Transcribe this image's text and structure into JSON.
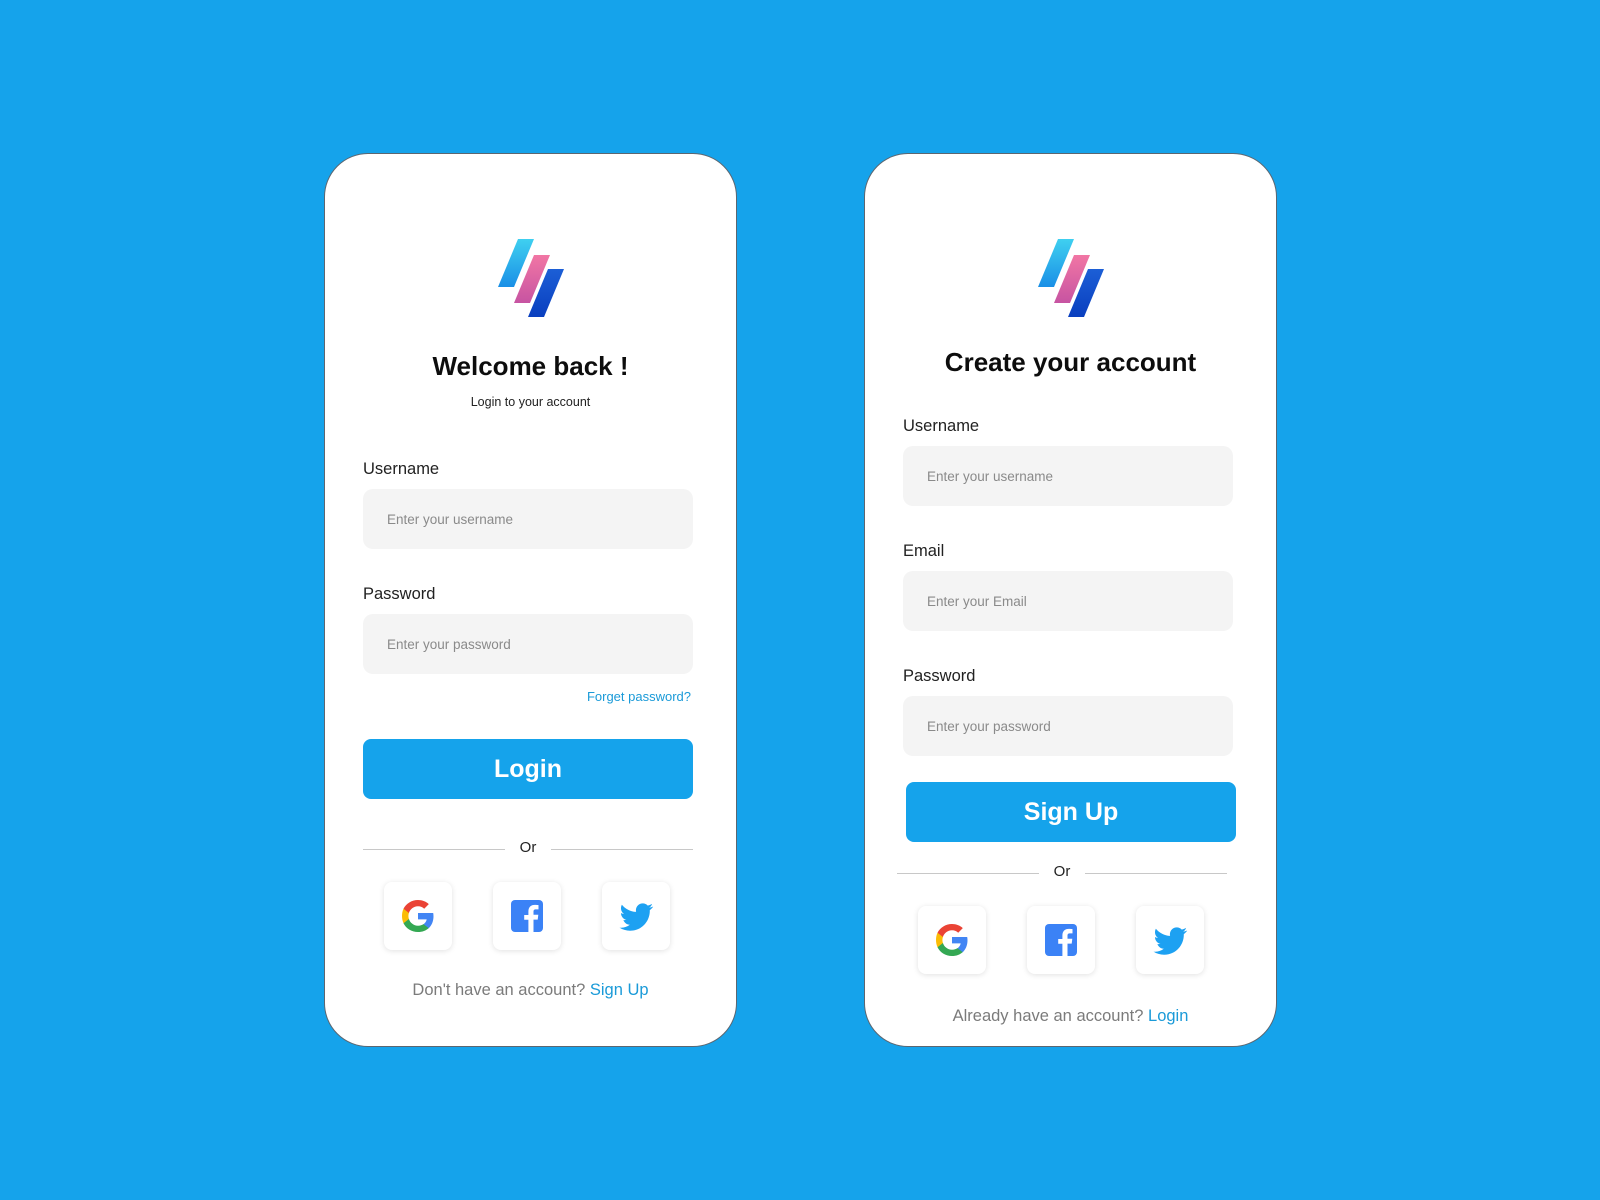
{
  "colors": {
    "background": "#15a3eb",
    "accent": "#15a3eb",
    "link": "#1a9ad8",
    "input_bg": "#f4f4f4"
  },
  "login": {
    "title": "Welcome back !",
    "subtitle": "Login to your account",
    "username_label": "Username",
    "username_placeholder": "Enter your username",
    "password_label": "Password",
    "password_placeholder": "Enter your password",
    "forgot_link": "Forget password?",
    "submit_label": "Login",
    "divider": "Or",
    "footer_text": "Don't have an account?",
    "footer_link": "Sign Up"
  },
  "signup": {
    "title": "Create your account",
    "username_label": "Username",
    "username_placeholder": "Enter your username",
    "email_label": "Email",
    "email_placeholder": "Enter your Email",
    "password_label": "Password",
    "password_placeholder": "Enter your password",
    "submit_label": "Sign Up",
    "divider": "Or",
    "footer_text": "Already have an account?",
    "footer_link": "Login"
  },
  "social_icons": [
    "google-icon",
    "facebook-icon",
    "twitter-icon"
  ]
}
